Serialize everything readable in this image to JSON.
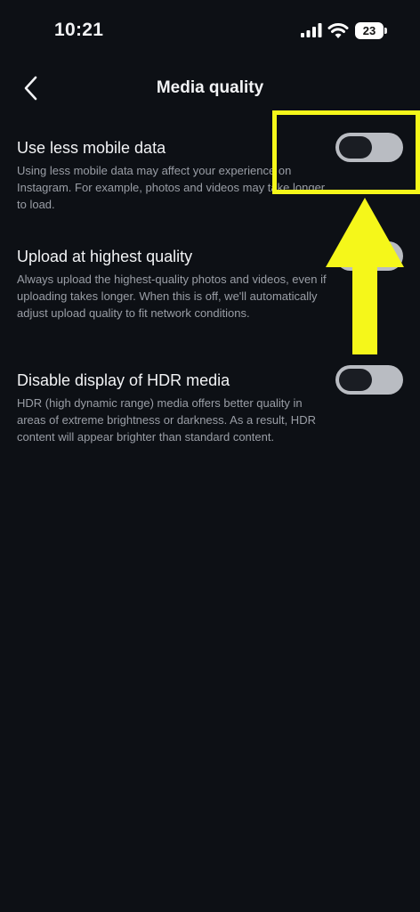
{
  "status_bar": {
    "time": "10:21",
    "battery": "23"
  },
  "header": {
    "title": "Media quality"
  },
  "settings": [
    {
      "title": "Use less mobile data",
      "description": "Using less mobile data may affect your experience on Instagram. For example, photos and videos may take longer to load.",
      "enabled": false
    },
    {
      "title": "Upload at highest quality",
      "description": "Always upload the highest-quality photos and videos, even if uploading takes longer. When this is off, we'll automatically adjust upload quality to fit network conditions.",
      "enabled": false
    },
    {
      "title": "Disable display of HDR media",
      "description": "HDR (high dynamic range) media offers better quality in areas of extreme brightness or darkness. As a result, HDR content will appear brighter than standard content.",
      "enabled": false
    }
  ],
  "colors": {
    "background": "#0d1015",
    "annotation": "#f5f71a",
    "toggle_track": "#b9bcc2"
  },
  "icons": {
    "back": "chevron-left-icon",
    "signal": "cellular-signal-icon",
    "wifi": "wifi-icon",
    "battery": "battery-icon"
  }
}
